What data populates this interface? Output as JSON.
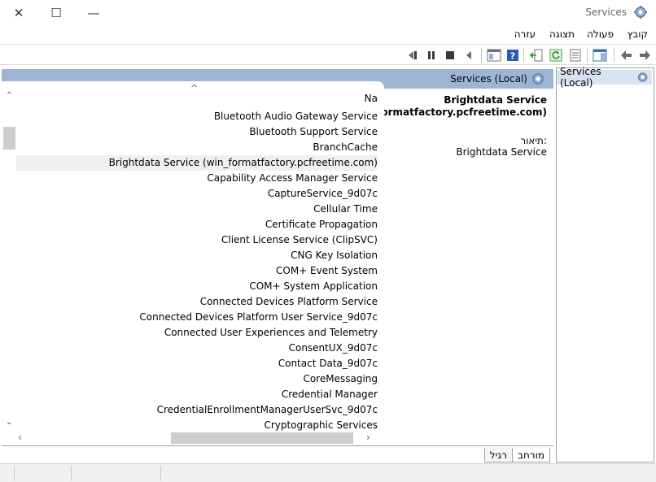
{
  "window": {
    "title": "Services",
    "controls": {
      "close": "✕",
      "maximize": "☐",
      "minimize": "—"
    }
  },
  "menu": {
    "file": "קובץ",
    "action": "פעולה",
    "view": "תצוגה",
    "help": "עזרה"
  },
  "tree": {
    "root_label": "Services (Local)"
  },
  "main": {
    "header_title": "Services (Local)",
    "detail": {
      "name_line1": "Brightdata Service",
      "name_line2": "(win_formatfactory.pcfreetime.com)",
      "description_label": "תיאור:",
      "description_value": "Brightdata Service"
    },
    "list": {
      "column_name": "Na",
      "sort_indicator": "^",
      "rows": [
        "Bluetooth Audio Gateway Service",
        "Bluetooth Support Service",
        "BranchCache",
        "Brightdata Service (win_formatfactory.pcfreetime.com)",
        "Capability Access Manager Service",
        "CaptureService_9d07c",
        "Cellular Time",
        "Certificate Propagation",
        "Client License Service (ClipSVC)",
        "CNG Key Isolation",
        "COM+ Event System",
        "COM+ System Application",
        "Connected Devices Platform Service",
        "Connected Devices Platform User Service_9d07c",
        "Connected User Experiences and Telemetry",
        "ConsentUX_9d07c",
        "Contact Data_9d07c",
        "CoreMessaging",
        "Credential Manager",
        "CredentialEnrollmentManagerUserSvc_9d07c",
        "Cryptographic Services"
      ],
      "selected_row": "Brightdata Service (win_formatfactory.pcfreetime.com)"
    },
    "tabs": {
      "extended": "מורחב",
      "standard": "רגיל"
    }
  },
  "icons": {
    "toolbar": [
      "back-icon",
      "forward-icon",
      "show-hide-tree-icon",
      "properties-icon",
      "refresh-icon",
      "export-icon",
      "help-icon",
      "console-icon",
      "start-icon",
      "stop-icon",
      "pause-icon",
      "restart-icon"
    ]
  },
  "colors": {
    "header_bg": "#9db5d3",
    "selection_bg": "#f0f0f0",
    "tree_selection_bg": "#d9e4f1"
  }
}
